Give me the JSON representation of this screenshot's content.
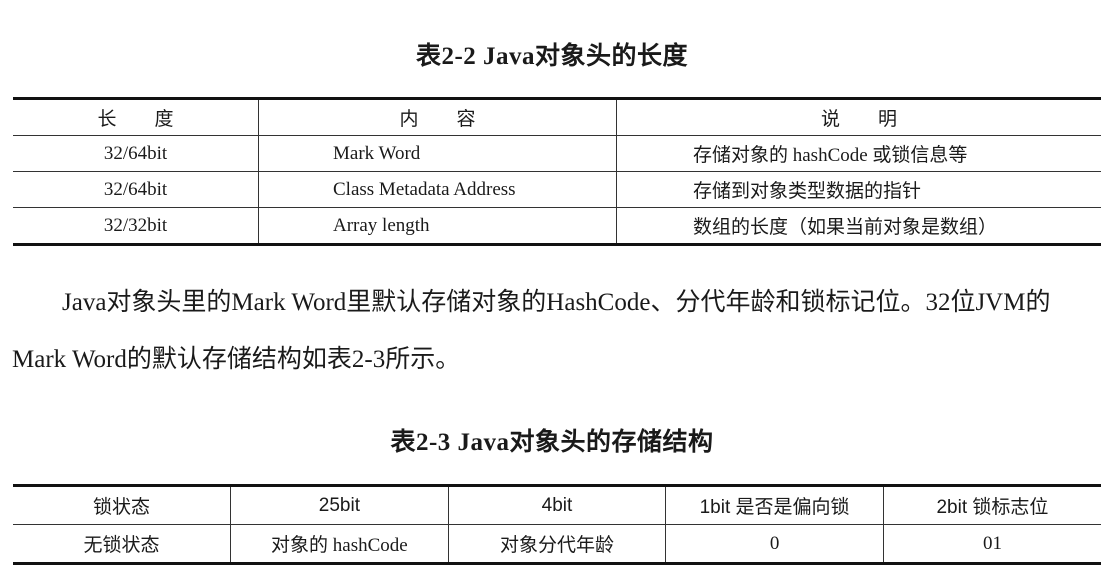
{
  "table1": {
    "caption": "表2-2  Java对象头的长度",
    "headers": [
      "长度",
      "内容",
      "说明"
    ],
    "rows": [
      [
        "32/64bit",
        "Mark Word",
        "存储对象的 hashCode 或锁信息等"
      ],
      [
        "32/64bit",
        "Class Metadata Address",
        "存储到对象类型数据的指针"
      ],
      [
        "32/32bit",
        "Array length",
        "数组的长度（如果当前对象是数组）"
      ]
    ]
  },
  "paragraph": "Java对象头里的Mark Word里默认存储对象的HashCode、分代年龄和锁标记位。32位JVM的Mark Word的默认存储结构如表2-3所示。",
  "table2": {
    "caption": "表2-3  Java对象头的存储结构",
    "headers": [
      "锁状态",
      "25bit",
      "4bit",
      "1bit 是否是偏向锁",
      "2bit 锁标志位"
    ],
    "rows": [
      [
        "无锁状态",
        "对象的 hashCode",
        "对象分代年龄",
        "0",
        "01"
      ]
    ]
  }
}
